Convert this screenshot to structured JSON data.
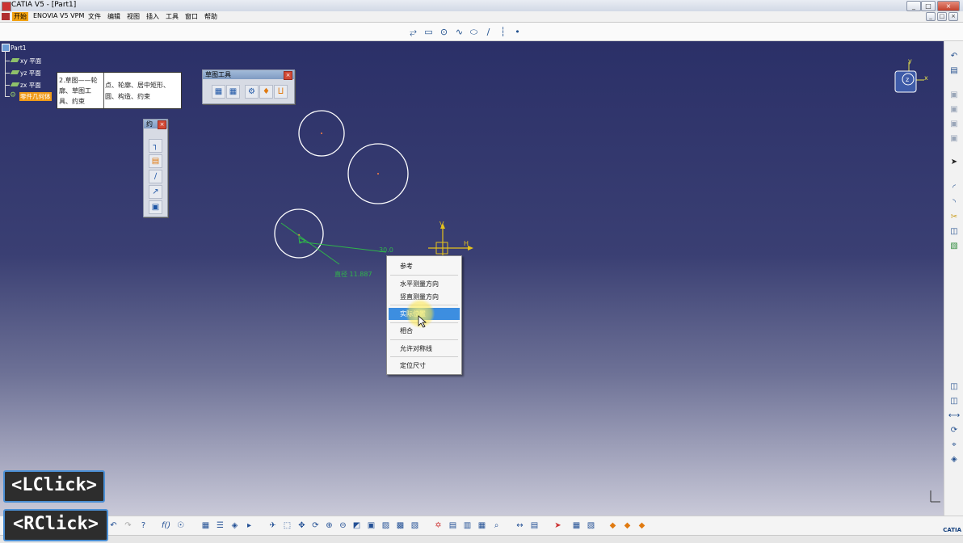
{
  "window": {
    "title": "CATIA V5 - [Part1]",
    "min": "_",
    "max": "□",
    "close": "×",
    "doc_min": "_",
    "doc_max": "□",
    "doc_close": "×"
  },
  "menubar": [
    "开始",
    "ENOVIA V5 VPM",
    "文件",
    "编辑",
    "视图",
    "插入",
    "工具",
    "窗口",
    "帮助"
  ],
  "tree": {
    "root": "Part1",
    "items": [
      "xy 平面",
      "yz 平面",
      "zx 平面",
      "零件几何体"
    ]
  },
  "tooltip": {
    "col1": "2.草图——轮廓、草图工具、约束",
    "col2": "点、轮廓、居中矩形、圆、构造、约束"
  },
  "sketch_tools": {
    "title": "草图工具",
    "close": "×"
  },
  "constraint_panel": {
    "title": "约",
    "close": "×"
  },
  "dimensions": {
    "dim1": "30.0",
    "dim2": "直径 11.887"
  },
  "axes": {
    "v": "V",
    "h": "H"
  },
  "compass": {
    "x": "x",
    "y": "y",
    "z": "z"
  },
  "context_menu": {
    "items": [
      "参考",
      "水平测量方向",
      "竖直测量方向",
      "实际位置",
      "相合",
      "允许对称线",
      "定位尺寸"
    ],
    "highlighted": 3
  },
  "keys": {
    "left": "<LClick>",
    "right": "<RClick>"
  },
  "logo": "CATIA",
  "colors": {
    "viewport_top": "#2b3068",
    "highlight": "#3d8ee0",
    "menu_active": "#f3a20f",
    "sketch_green": "#2fb54a"
  }
}
